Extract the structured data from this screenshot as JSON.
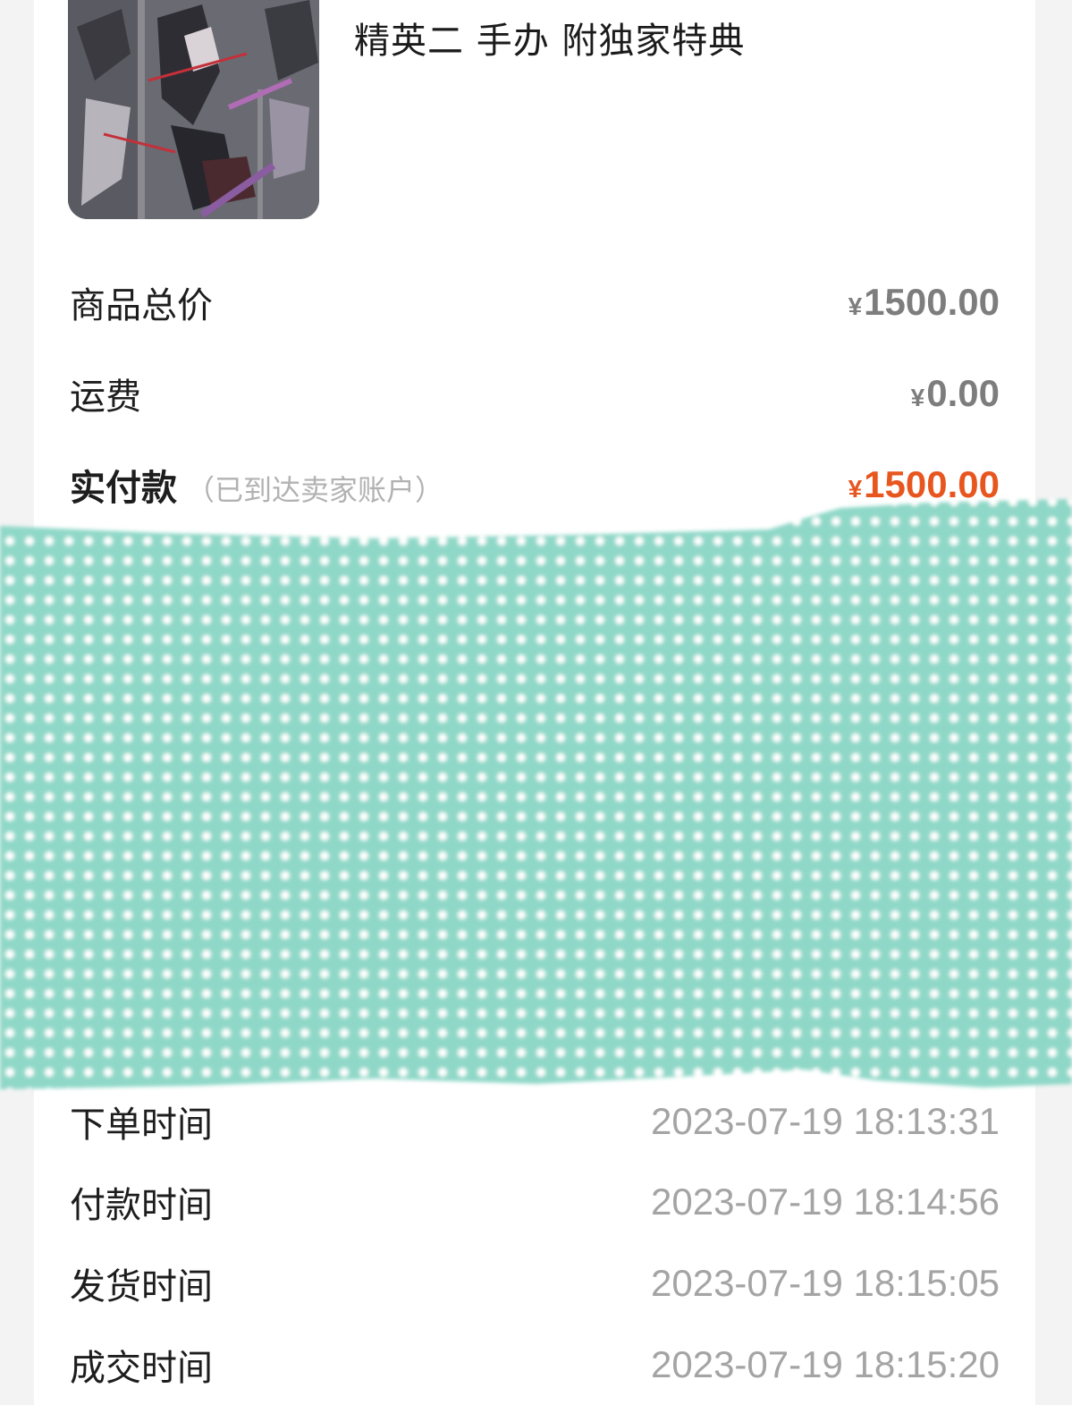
{
  "product": {
    "title": "精英二 手办 附独家特典",
    "image_icon": "figure-product-photo"
  },
  "pricing": {
    "goods_total_label": "商品总价",
    "goods_total_value": "1500.00",
    "shipping_label": "运费",
    "shipping_value": "0.00",
    "paid_label": "实付款",
    "paid_note": "（已到达卖家账户）",
    "paid_value": "1500.00",
    "currency_symbol": "¥"
  },
  "timeline": [
    {
      "label": "下单时间",
      "value": "2023-07-19 18:13:31"
    },
    {
      "label": "付款时间",
      "value": "2023-07-19 18:14:56"
    },
    {
      "label": "发货时间",
      "value": "2023-07-19 18:15:05"
    },
    {
      "label": "成交时间",
      "value": "2023-07-19 18:15:20"
    }
  ],
  "colors": {
    "accent_price": "#e8561f",
    "mask_teal": "#8fd8c8",
    "mask_dot": "#ffffff"
  }
}
